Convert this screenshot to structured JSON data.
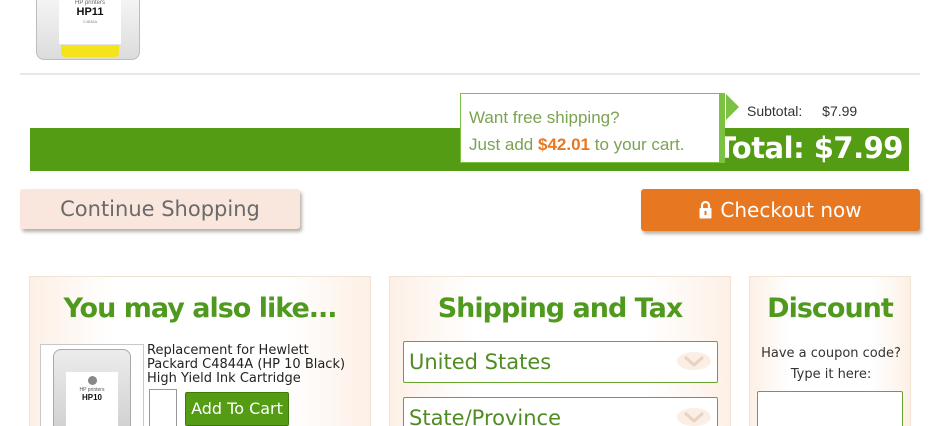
{
  "top_product": {
    "brand_text": "HP printers",
    "model": "HP11",
    "sub": "C4836A"
  },
  "summary": {
    "subtotal_label": "Subtotal:",
    "subtotal_value": "$7.99",
    "grand_total_text": "d Total: $7.99"
  },
  "free_shipping": {
    "line1": "Want free shipping?",
    "line2_prefix": "Just add ",
    "amount": "$42.01",
    "line2_suffix": " to your cart."
  },
  "buttons": {
    "continue_label": "Continue Shopping",
    "checkout_label": "Checkout now"
  },
  "recommend": {
    "title": "You may also like...",
    "item": {
      "description": "Replacement for Hewlett Packard C4844A (HP 10 Black) High Yield Ink Cartridge",
      "image_brand": "HP printers",
      "image_model": "HP10",
      "add_label": "Add To Cart"
    }
  },
  "shipping": {
    "title": "Shipping and Tax",
    "country_value": "United States",
    "state_value": "State/Province"
  },
  "discount": {
    "title": "Discount",
    "prompt_line1": "Have a coupon code?",
    "prompt_line2": "Type it here:"
  },
  "colors": {
    "green": "#549c14",
    "orange": "#e87722",
    "light_green": "#7cc242",
    "peach": "#f9e7dd"
  }
}
